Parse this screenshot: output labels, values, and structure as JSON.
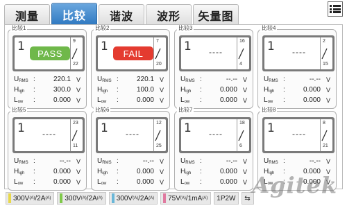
{
  "tabs": [
    {
      "label": "测量",
      "active": false
    },
    {
      "label": "比较",
      "active": true
    },
    {
      "label": "谐波",
      "active": false
    },
    {
      "label": "波形",
      "active": false
    },
    {
      "label": "矢量图",
      "active": false
    }
  ],
  "menu_icon": "menu-list-icon",
  "panels": [
    {
      "title": "比较1",
      "channel": "1",
      "status": "PASS",
      "status_type": "pass",
      "sw_top": "9",
      "sw_bot": "22",
      "urms_label": "U",
      "urms_sub": "RMS",
      "high_label": "H",
      "high_sub": "igh",
      "low_label": "L",
      "low_sub": "ow",
      "urms": "220.1",
      "high": "300.0",
      "low": "0.000",
      "unit": "V"
    },
    {
      "title": "比较2",
      "channel": "1",
      "status": "FAIL",
      "status_type": "fail",
      "sw_top": "7",
      "sw_bot": "20",
      "urms_label": "U",
      "urms_sub": "RMS",
      "high_label": "H",
      "high_sub": "igh",
      "low_label": "L",
      "low_sub": "ow",
      "urms": "220.1",
      "high": "100.0",
      "low": "0.000",
      "unit": "V"
    },
    {
      "title": "比较3",
      "channel": "1",
      "status": "----",
      "status_type": "none",
      "sw_top": "16",
      "sw_bot": "4",
      "urms_label": "U",
      "urms_sub": "RMS",
      "high_label": "H",
      "high_sub": "igh",
      "low_label": "L",
      "low_sub": "ow",
      "urms": "--.--",
      "high": "0.000",
      "low": "0.000",
      "unit": "V"
    },
    {
      "title": "比较4",
      "channel": "1",
      "status": "----",
      "status_type": "none",
      "sw_top": "2",
      "sw_bot": "15",
      "urms_label": "U",
      "urms_sub": "RMS",
      "high_label": "H",
      "high_sub": "igh",
      "low_label": "L",
      "low_sub": "ow",
      "urms": "--.--",
      "high": "0.000",
      "low": "0.000",
      "unit": "V"
    },
    {
      "title": "比较5",
      "channel": "1",
      "status": "----",
      "status_type": "none",
      "sw_top": "23",
      "sw_bot": "11",
      "urms_label": "U",
      "urms_sub": "RMS",
      "high_label": "H",
      "high_sub": "igh",
      "low_label": "L",
      "low_sub": "ow",
      "urms": "--.--",
      "high": "0.000",
      "low": "0.000",
      "unit": "V"
    },
    {
      "title": "比较6",
      "channel": "1",
      "status": "----",
      "status_type": "none",
      "sw_top": "12",
      "sw_bot": "25",
      "urms_label": "U",
      "urms_sub": "RMS",
      "high_label": "H",
      "high_sub": "igh",
      "low_label": "L",
      "low_sub": "ow",
      "urms": "--.--",
      "high": "0.000",
      "low": "0.000",
      "unit": "V"
    },
    {
      "title": "比较7",
      "channel": "1",
      "status": "----",
      "status_type": "none",
      "sw_top": "18",
      "sw_bot": "6",
      "urms_label": "U",
      "urms_sub": "RMS",
      "high_label": "H",
      "high_sub": "igh",
      "low_label": "L",
      "low_sub": "ow",
      "urms": "--.--",
      "high": "0.000",
      "low": "0.000",
      "unit": "V"
    },
    {
      "title": "比较8",
      "channel": "1",
      "status": "----",
      "status_type": "none",
      "sw_top": "8",
      "sw_bot": "21",
      "urms_label": "U",
      "urms_sub": "RMS",
      "high_label": "H",
      "high_sub": "igh",
      "low_label": "L",
      "low_sub": "ow",
      "urms": "--.--",
      "high": "0.000",
      "low": "0.000",
      "unit": "V"
    }
  ],
  "colon": ":",
  "statusbar": {
    "ranges": [
      {
        "main": "300V",
        "sub1": "(A)",
        "mid": "/2A",
        "sub2": "(A)",
        "color": "#e8d84a"
      },
      {
        "main": "300V",
        "sub1": "(A)",
        "mid": "/2A",
        "sub2": "(A)",
        "color": "#7fc94a"
      },
      {
        "main": "300V",
        "sub1": "(A)",
        "mid": "/2A",
        "sub2": "(A)",
        "color": "#6ab7d8"
      },
      {
        "main": "75V",
        "sub1": "(A)",
        "mid": "/1mA",
        "sub2": "(A)",
        "color": "#e07aa0"
      }
    ],
    "wiring": "1P2W",
    "usb_icon": "usb-icon"
  },
  "watermark": "Agitek",
  "colors": {
    "accent": "#2f79c1",
    "pass": "#6fb84a",
    "fail": "#e43b30"
  }
}
